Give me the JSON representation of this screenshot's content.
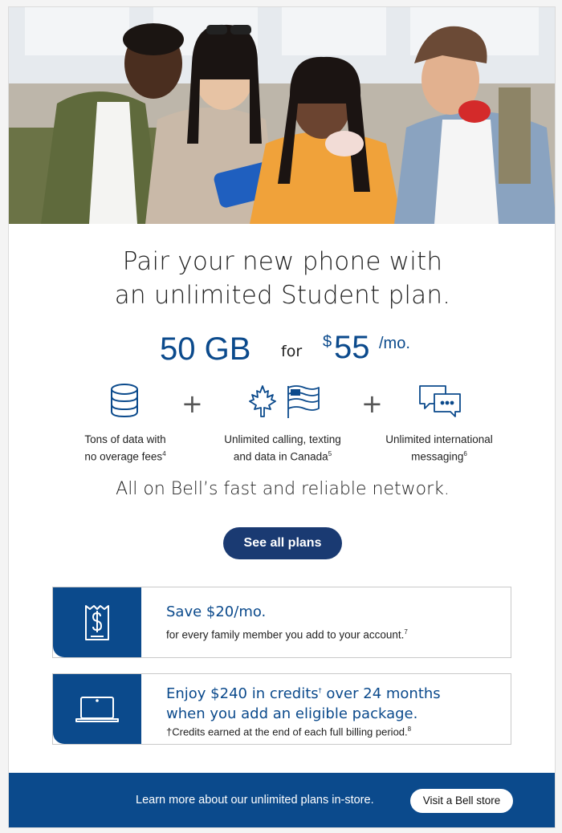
{
  "hero": {
    "image_alt": "Four students taking a selfie with a blue smartphone"
  },
  "headline": {
    "line1": "Pair your new phone with",
    "line2": "an unlimited Student plan."
  },
  "offer": {
    "data_amount": "50 GB",
    "connector": "for",
    "currency": "$",
    "price": "55",
    "period": "/mo."
  },
  "features": [
    {
      "icon": "data-stack-icon",
      "text_line1": "Tons of data with",
      "text_line2": "no overage fees",
      "footnote": "4"
    },
    {
      "icon": "canada-us-flag-icon",
      "text_line1": "Unlimited calling, texting",
      "text_line2": "and data in Canada",
      "footnote": "5"
    },
    {
      "icon": "messaging-icon",
      "text_line1": "Unlimited international",
      "text_line2": "messaging",
      "footnote": "6"
    }
  ],
  "plus_symbol": "+",
  "network_text": "All on Bell’s fast and reliable network.",
  "cta": {
    "label": "See all plans"
  },
  "promos": [
    {
      "icon": "receipt-dollar-icon",
      "title": "Save $20/mo.",
      "subtitle": "for every family member you add to your account.",
      "footnote": "7"
    },
    {
      "icon": "laptop-icon",
      "title_line1_pre": "Enjoy $240 in credits",
      "title_line1_mark": "†",
      "title_line1_post": " over 24 months",
      "title_line2": "when you add an eligible package.",
      "subtitle": "†Credits earned at the end of each full billing period.",
      "footnote": "8"
    }
  ],
  "footer": {
    "text": "Learn more about our unlimited plans in-store.",
    "button_label": "Visit a Bell store"
  },
  "colors": {
    "brand_blue": "#0b4a8c",
    "cta_navy": "#1a3a72"
  }
}
